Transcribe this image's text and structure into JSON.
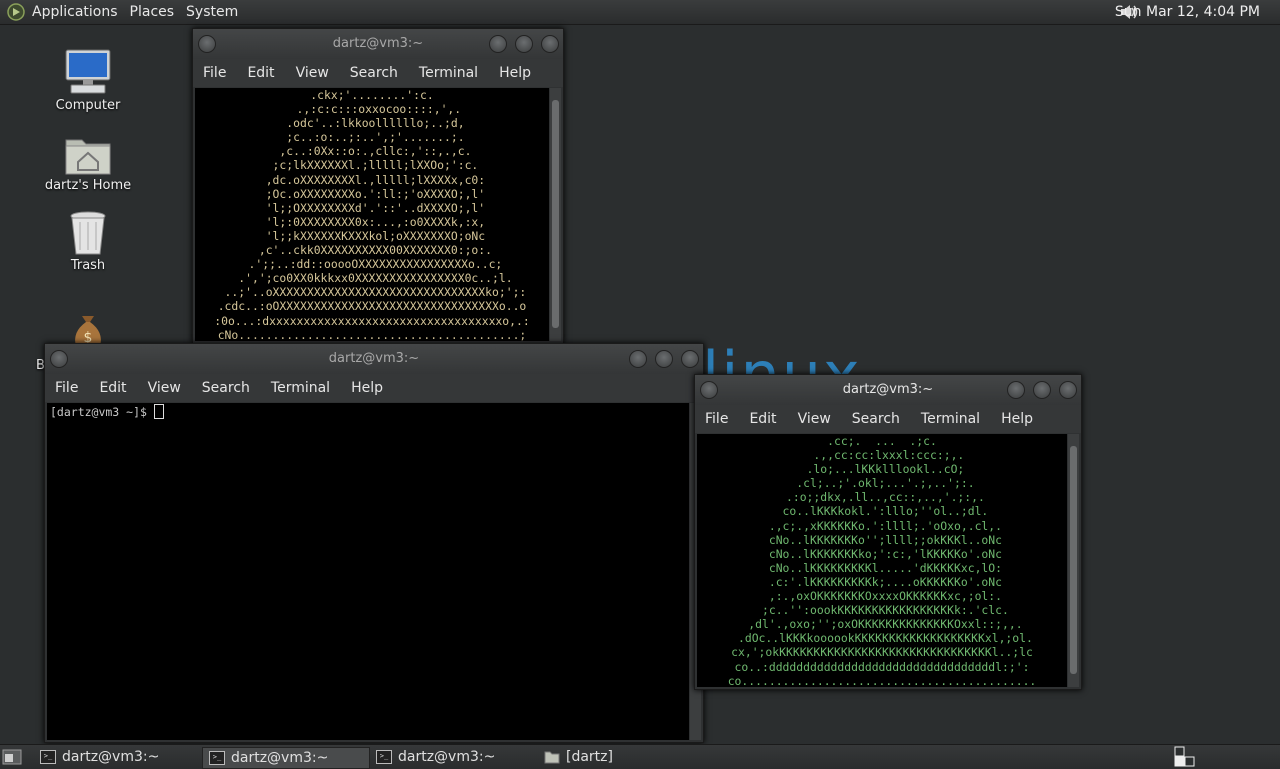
{
  "top_panel": {
    "menus": [
      "Applications",
      "Places",
      "System"
    ],
    "clock": "Sun Mar 12,  4:04 PM",
    "icons": {
      "logo": "distro-logo-icon",
      "volume": "volume-icon"
    }
  },
  "desktop": {
    "icons": [
      {
        "label": "Computer",
        "icon": "computer-icon"
      },
      {
        "label": "dartz's Home",
        "icon": "home-folder-icon"
      },
      {
        "label": "Trash",
        "icon": "trash-icon"
      },
      {
        "label": "B",
        "icon": "money-bag-icon"
      }
    ],
    "wallpaper_text": "linux"
  },
  "windows": [
    {
      "title": "dartz@vm3:~",
      "menus": [
        "File",
        "Edit",
        "View",
        "Search",
        "Terminal",
        "Help"
      ],
      "text_color": "#d6c79a",
      "lines": [
        ".ckx;'........':c.",
        "  .,:c:c:::oxxocoo::::,',.",
        " .odc'..:lkkoollllllo;..;d,",
        " ;c..:o:..;:..',;'.......;.",
        " ,c..:0Xx::o:.,cllc:,'::,.,c.",
        " ;c;lkXXXXXXl.;lllll;lXXOo;':c.",
        " ,dc.oXXXXXXXXl.,lllll;lXXXXx,c0:",
        " ;Oc.oXXXXXXXXo.':ll:;'oXXXXO;,l'",
        " 'l;;OXXXXXXXXd'.'::'..dXXXXO;,l'",
        " 'l;:0XXXXXXXX0x:...,:o0XXXXk,:x,",
        " 'l;;kXXXXXXKXXXkol;oXXXXXXXO;oNc",
        " ,c'..ckk0XXXXXXXXXX00XXXXXXX0:;o:.",
        " .';;..:dd::ooooOXXXXXXXXXXXXXXXXo..c;",
        " .',';co0XX0kkkxx0XXXXXXXXXXXXXXXX0c..;l.",
        " ..;'..oXXXXXXXXXXXXXXXXXXXXXXXXXXXXXXXko;';:",
        ".cdc..:oOXXXXXXXXXXXXXXXXXXXXXXXXXXXXXXXXo..o",
        ":0o...:dxxxxxxxxxxxxxxxxxxxxxxxxxxxxxxxxxxo,.:",
        "cNo.........................................;"
      ]
    },
    {
      "title": "dartz@vm3:~",
      "menus": [
        "File",
        "Edit",
        "View",
        "Search",
        "Terminal",
        "Help"
      ],
      "prompt": "[dartz@vm3 ~]$ "
    },
    {
      "title": "dartz@vm3:~",
      "menus": [
        "File",
        "Edit",
        "View",
        "Search",
        "Terminal",
        "Help"
      ],
      "text_color": "#6fb86f",
      "lines": [
        ".cc;.  ...  .;c.",
        "  .,,cc:cc:lxxxl:ccc:;,.",
        " .lo;...lKKklllookl..cO;",
        " .cl;..;'.okl;...'.;,..';:.",
        " .:o;;dkx,.ll..,cc::,..,'.;:,.",
        " co..lKKKkokl.':lllo;''ol..;dl.",
        " .,c;.,xKKKKKKo.':llll;.'oOxo,.cl,.",
        " cNo..lKKKKKKKo'';llll;;okKKKl..oNc",
        " cNo..lKKKKKKKko;':c:,'lKKKKKo'.oNc",
        " cNo..lKKKKKKKKKl.....'dKKKKKxc,lO:",
        " .c:'.lKKKKKKKKKk;....oKKKKKKo'.oNc",
        " ,:.,oxOKKKKKKKOxxxxOKKKKKKxc,;ol:.",
        " ;c..'':oookKKKKKKKKKKKKKKKKKk:.'clc.",
        " ,dl'.,oxo;'';oxOKKKKKKKKKKKKKKOxxl::;,,.",
        " .dOc..lKKKkoooookKKKKKKKKKKKKKKKKKKKxl,;ol.",
        "cx,';okKKKKKKKKKKKKKKKKKKKKKKKKKKKKKKKl..;lc",
        "co..:dddddddddddddddddddddddddddddddddl:;':",
        "co..........................................."
      ]
    }
  ],
  "taskbar": {
    "items": [
      {
        "label": "dartz@vm3:~",
        "icon": "terminal-icon"
      },
      {
        "label": "dartz@vm3:~",
        "icon": "terminal-icon"
      },
      {
        "label": "dartz@vm3:~",
        "icon": "terminal-icon"
      },
      {
        "label": "[dartz]",
        "icon": "folder-icon"
      }
    ],
    "icons": {
      "show_desktop": "show-desktop-icon",
      "workspace": "workspace-switcher-icon"
    }
  }
}
